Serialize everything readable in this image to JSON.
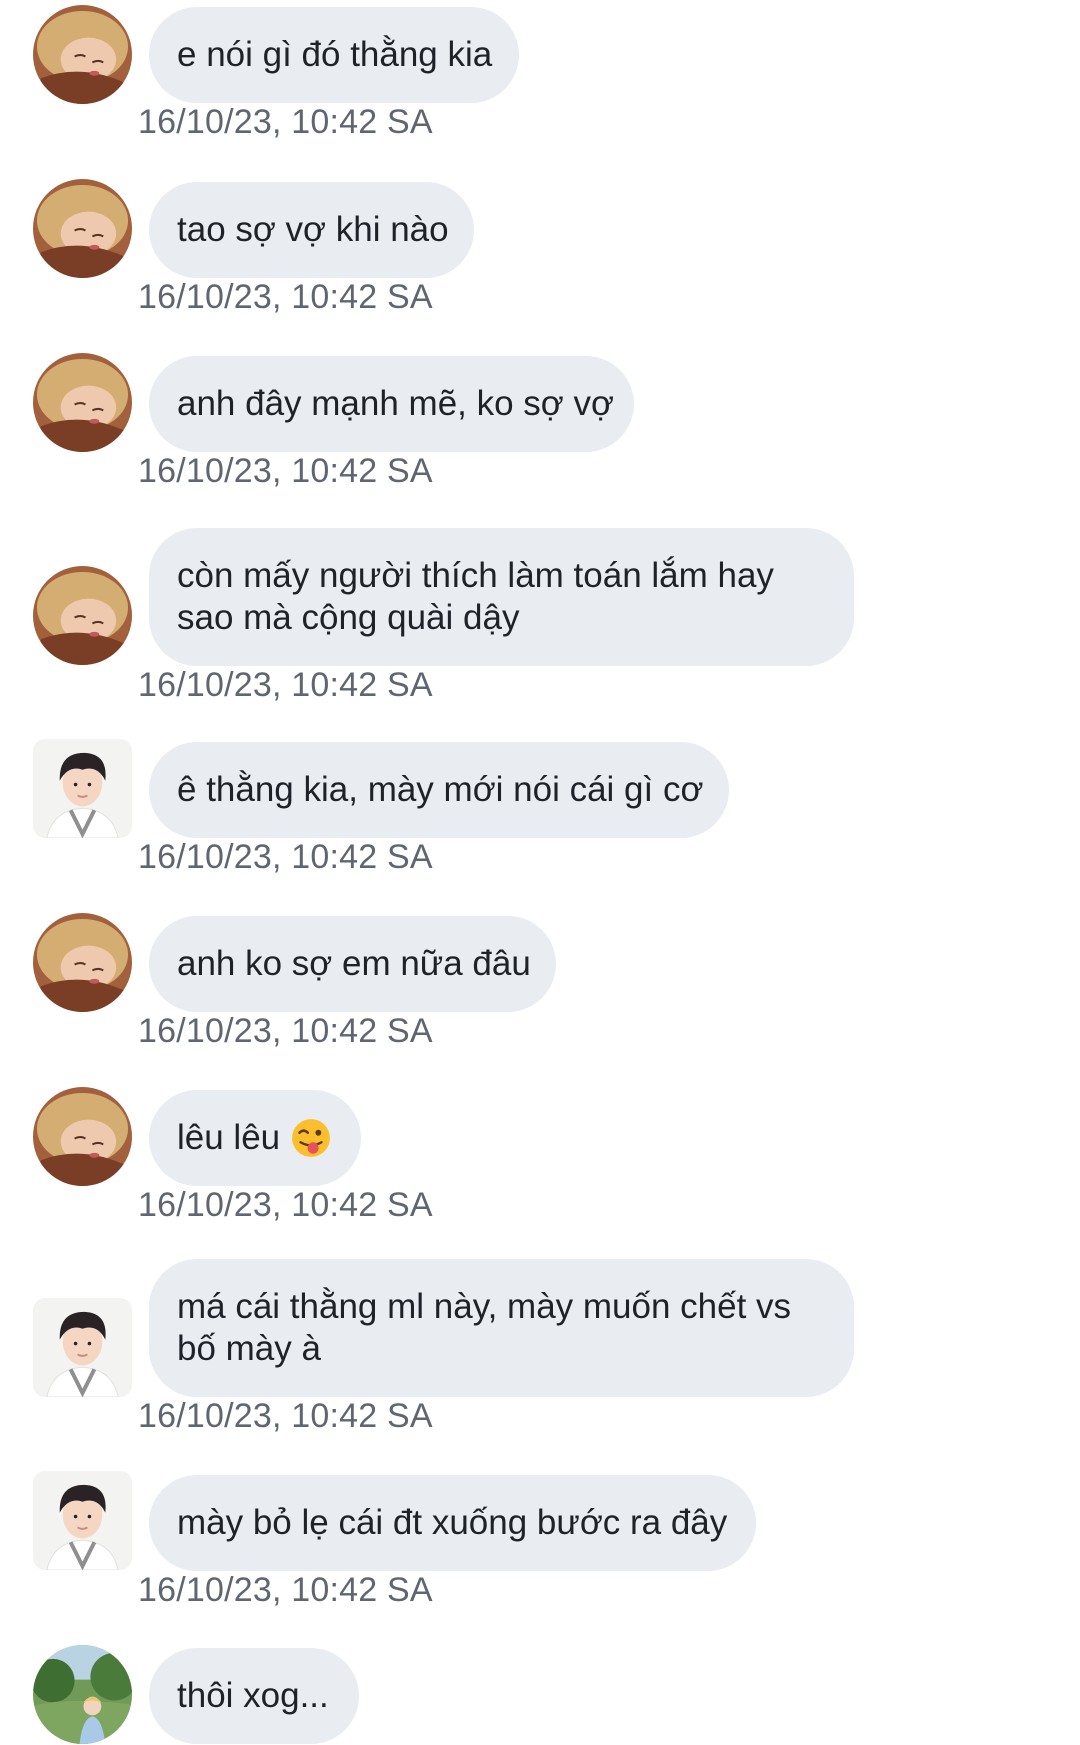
{
  "messages": [
    {
      "sender": "girl",
      "text": [
        "e nói gì đó thằng kia"
      ],
      "time": "16/10/23, 10:42 SA"
    },
    {
      "sender": "girl",
      "text": [
        "tao sợ vợ khi nào"
      ],
      "time": "16/10/23, 10:42 SA"
    },
    {
      "sender": "girl",
      "text": [
        "anh đây mạnh mẽ, ko sợ vợ"
      ],
      "time": "16/10/23, 10:42 SA"
    },
    {
      "sender": "girl",
      "text": [
        "còn mấy người thích làm toán lắm hay",
        "sao mà cộng quài dậy"
      ],
      "time": "16/10/23, 10:42 SA"
    },
    {
      "sender": "boy",
      "text": [
        "ê thằng kia, mày mới nói cái gì cơ"
      ],
      "time": "16/10/23, 10:42 SA"
    },
    {
      "sender": "girl",
      "text": [
        "anh ko sợ em nữa đâu"
      ],
      "time": "16/10/23, 10:42 SA"
    },
    {
      "sender": "girl",
      "text": [
        "lêu lêu"
      ],
      "emoji": "winking-face-with-tongue-icon",
      "time": "16/10/23, 10:42 SA"
    },
    {
      "sender": "boy",
      "text": [
        "má cái thằng ml này, mày muốn chết vs",
        "bố mày à"
      ],
      "time": "16/10/23, 10:42 SA"
    },
    {
      "sender": "boy",
      "text": [
        "mày bỏ lẹ cái đt xuống bước ra đây"
      ],
      "time": "16/10/23, 10:42 SA"
    },
    {
      "sender": "outdoor",
      "text": [
        "thôi xog..."
      ],
      "time": ""
    }
  ],
  "colors": {
    "bubble": "#e9ecf1",
    "text": "#1f2329",
    "timestamp": "#5f6670"
  }
}
